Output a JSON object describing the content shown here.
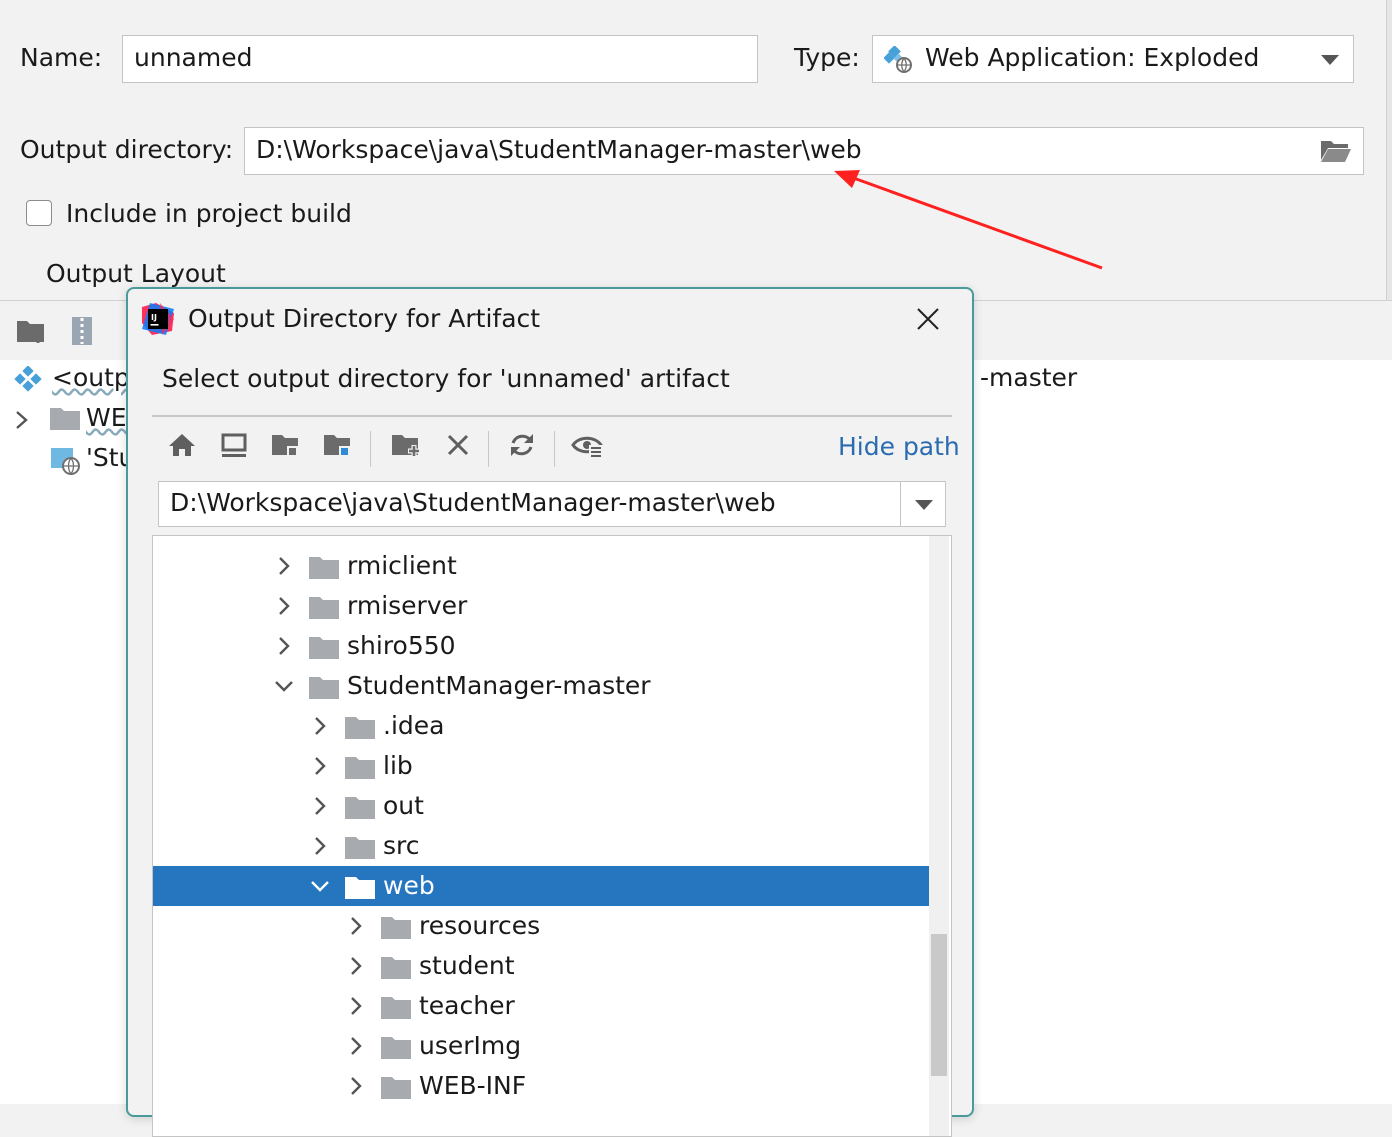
{
  "form": {
    "name_label": "Name:",
    "name_value": "unnamed",
    "type_label": "Type:",
    "type_value": "Web Application: Exploded",
    "output_dir_label": "Output directory:",
    "output_dir_value": "D:\\Workspace\\java\\StudentManager-master\\web",
    "include_label": "Include in project build",
    "include_checked": false,
    "output_layout_tab": "Output Layout"
  },
  "background_tree": {
    "row1": "<outp",
    "row1_suffix": "-master",
    "row2": "WE",
    "row3": "'Stu"
  },
  "dialog": {
    "title": "Output Directory for Artifact",
    "subtitle": "Select output directory for 'unnamed' artifact",
    "hide_path": "Hide path",
    "path_value": "D:\\Workspace\\java\\StudentManager-master\\web",
    "toolbar_icons": [
      "home-icon",
      "desktop-icon",
      "project-folder-icon",
      "module-folder-icon",
      "new-folder-icon",
      "delete-icon",
      "refresh-icon",
      "show-hidden-icon"
    ],
    "tree": [
      {
        "label": "rmiclient",
        "depth": 0,
        "expanded": false
      },
      {
        "label": "rmiserver",
        "depth": 0,
        "expanded": false
      },
      {
        "label": "shiro550",
        "depth": 0,
        "expanded": false
      },
      {
        "label": "StudentManager-master",
        "depth": 0,
        "expanded": true
      },
      {
        "label": ".idea",
        "depth": 1,
        "expanded": false
      },
      {
        "label": "lib",
        "depth": 1,
        "expanded": false
      },
      {
        "label": "out",
        "depth": 1,
        "expanded": false
      },
      {
        "label": "src",
        "depth": 1,
        "expanded": false
      },
      {
        "label": "web",
        "depth": 1,
        "expanded": true,
        "selected": true
      },
      {
        "label": "resources",
        "depth": 2,
        "expanded": false
      },
      {
        "label": "student",
        "depth": 2,
        "expanded": false
      },
      {
        "label": "teacher",
        "depth": 2,
        "expanded": false
      },
      {
        "label": "userImg",
        "depth": 2,
        "expanded": false
      },
      {
        "label": "WEB-INF",
        "depth": 2,
        "expanded": false
      }
    ]
  },
  "colors": {
    "selection": "#2675bf",
    "link": "#2b6cb0",
    "annotation_arrow": "#ff2020",
    "dialog_border": "#4a9a9a"
  }
}
